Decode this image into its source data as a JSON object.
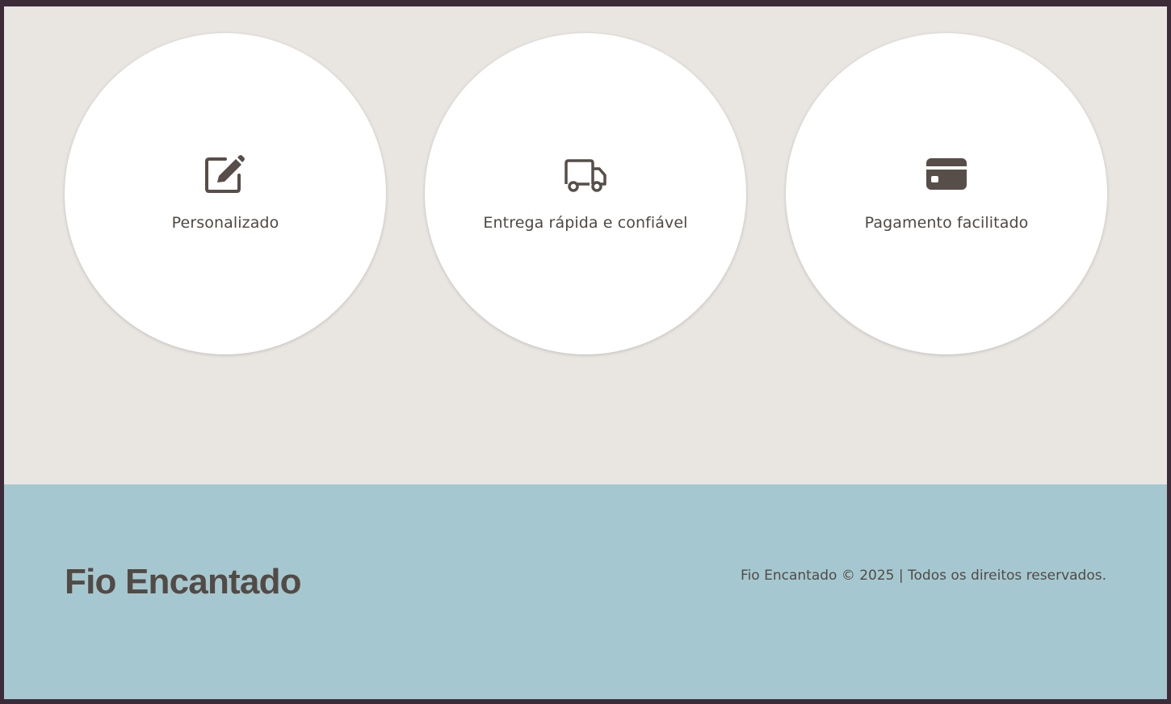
{
  "features": [
    {
      "icon": "edit-icon",
      "label": "Personalizado"
    },
    {
      "icon": "truck-icon",
      "label": "Entrega rápida e confiável"
    },
    {
      "icon": "credit-card-icon",
      "label": "Pagamento facilitado"
    }
  ],
  "footer": {
    "brand": "Fio Encantado",
    "copyright": "Fio Encantado © 2025 | Todos os direitos reservados."
  },
  "colors": {
    "background": "#e9e6e2",
    "card": "#ffffff",
    "text": "#534a45",
    "footer": "#a5c8d0",
    "frame": "#3d2b3a"
  }
}
